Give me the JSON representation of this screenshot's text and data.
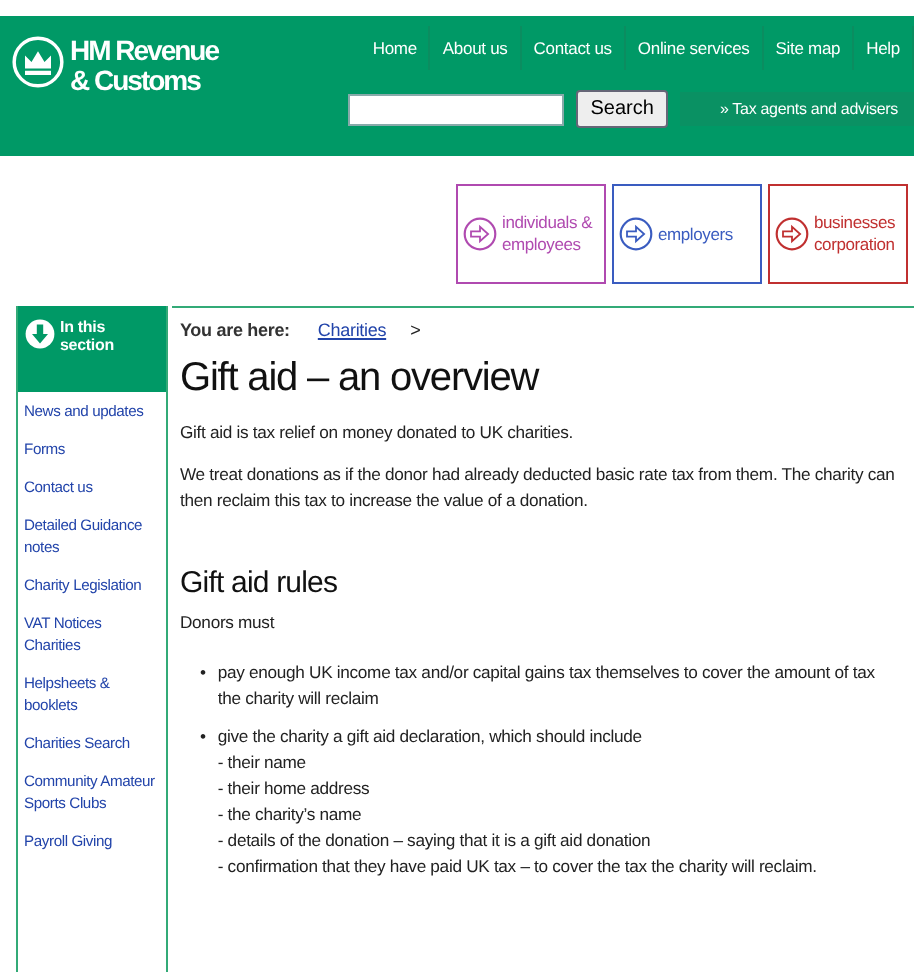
{
  "header": {
    "logo_line1": "HM Revenue",
    "logo_line2": "& Customs",
    "nav": [
      "Home",
      "About us",
      "Contact us",
      "Online services",
      "Site map",
      "Help"
    ],
    "search_button": "Search",
    "agents_link": "» Tax agents and advisers"
  },
  "audience_tabs": [
    {
      "lines": [
        "individuals &",
        "employees"
      ],
      "color": "#b04ab0"
    },
    {
      "lines": [
        "employers"
      ],
      "color": "#3a5cc0"
    },
    {
      "lines": [
        "businesses",
        "corporation"
      ],
      "color": "#c03030"
    }
  ],
  "sidebar": {
    "heading": [
      "In this",
      "section"
    ],
    "items": [
      "News and updates",
      "Forms",
      "Contact us",
      "Detailed Guidance notes",
      "Charity Legislation",
      "VAT Notices Charities",
      "Helpsheets & booklets",
      "Charities Search",
      "Community Amateur Sports Clubs",
      "Payroll Giving"
    ]
  },
  "breadcrumb": {
    "label": "You are here:",
    "link": "Charities",
    "separator": ">"
  },
  "title": "Gift aid – an overview",
  "paragraphs": [
    "Gift aid is tax relief on money donated to UK charities.",
    "We treat donations as if the donor had already deducted basic rate tax from them. The charity can then reclaim this tax to increase the value of a donation."
  ],
  "section_heading": "Gift aid rules",
  "intro": "Donors must",
  "bullets": [
    {
      "marker": "•",
      "text": "pay enough UK income tax and/or capital gains tax themselves to cover the amount of tax the charity will reclaim"
    },
    {
      "marker": "•",
      "text": "give the charity a gift aid declaration, which should include",
      "sublines": [
        "- their name",
        "- their home address",
        "- the charity’s name",
        "- details of the donation – saying that it is a gift aid donation",
        "- confirmation that they have paid UK tax – to cover the tax the charity will reclaim."
      ]
    }
  ]
}
